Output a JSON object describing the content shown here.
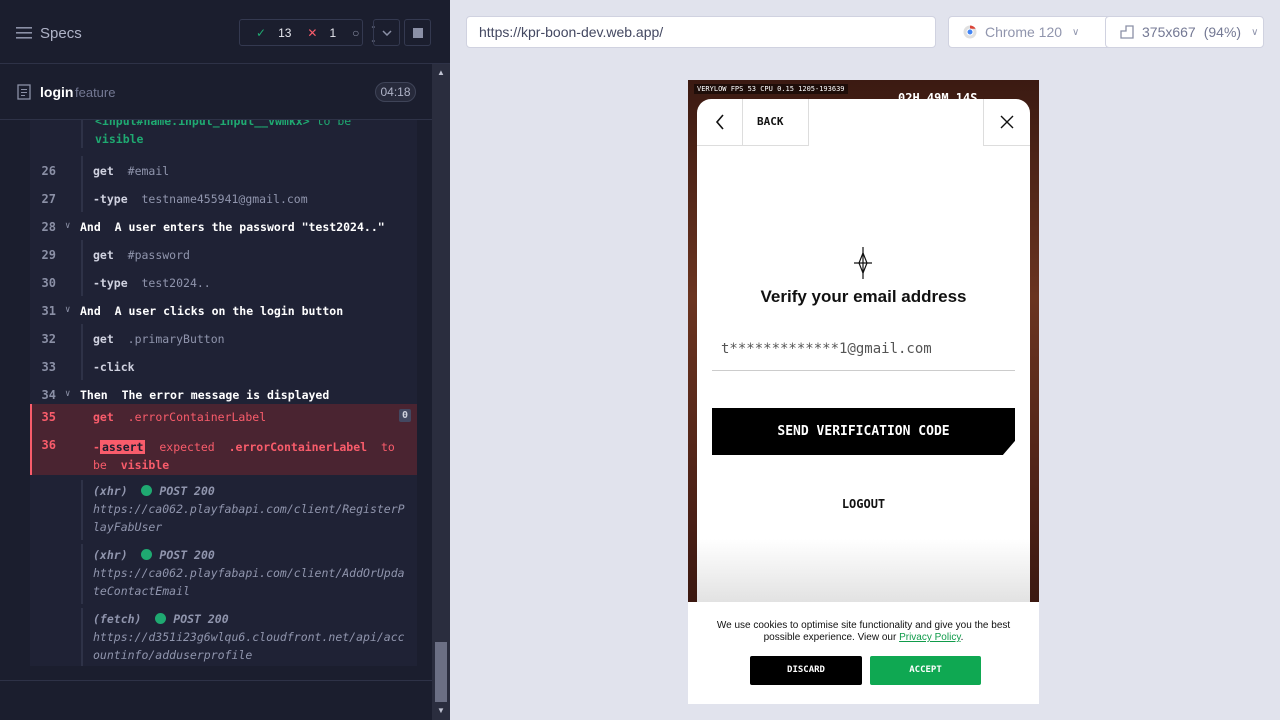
{
  "topbar": {
    "specs_label": "Specs",
    "passed": "13",
    "failed": "1",
    "pending": "--"
  },
  "spec": {
    "name": "login",
    "ext": "feature",
    "duration": "04:18"
  },
  "log": {
    "partial_top_1": "<input#name.input_input__vwmkx>",
    "partial_top_2": "to be",
    "partial_top_3": "visible",
    "lines": [
      {
        "num": "26",
        "cmd": "get",
        "arg": "#email"
      },
      {
        "num": "27",
        "cmd": "-type",
        "arg": "testname455941@gmail.com"
      },
      {
        "num": "28",
        "cmd": "And",
        "arg": "A user enters the password \"test2024..\""
      },
      {
        "num": "29",
        "cmd": "get",
        "arg": "#password"
      },
      {
        "num": "30",
        "cmd": "-type",
        "arg": "test2024.."
      },
      {
        "num": "31",
        "cmd": "And",
        "arg": "A user clicks on the login button"
      },
      {
        "num": "32",
        "cmd": "get",
        "arg": ".primaryButton"
      },
      {
        "num": "33",
        "cmd": "-click",
        "arg": ""
      },
      {
        "num": "34",
        "cmd": "Then",
        "arg": "The error message is displayed"
      },
      {
        "num": "35",
        "cmd": "get",
        "arg": ".errorContainerLabel"
      },
      {
        "num": "36",
        "cmd": "assert",
        "arg": "expected"
      }
    ],
    "line35_badge": "0",
    "assert_prefix": "-",
    "assert_label": "assert",
    "assert_expected": "expected",
    "assert_subject": ".errorContainerLabel",
    "assert_to": "to",
    "assert_be": "be",
    "assert_visible": "visible",
    "requests": [
      {
        "type": "(xhr)",
        "method": "POST 200",
        "url": "https://ca062.playfabapi.com/client/RegisterP",
        "url2": "layFabUser"
      },
      {
        "type": "(xhr)",
        "method": "POST 200",
        "url": "https://ca062.playfabapi.com/client/AddOrUpda",
        "url2": "teContactEmail"
      },
      {
        "type": "(fetch)",
        "method": "POST 200",
        "url": "https://d351i23g6wlqu6.cloudfront.net/api/acc",
        "url2": "ountinfo/adduserprofile"
      }
    ]
  },
  "aut": {
    "url": "https://kpr-boon-dev.web.app/",
    "browser": "Chrome 120",
    "viewport": "375x667",
    "zoom": "(94%)"
  },
  "app": {
    "perf": "VERYLOW  FPS 53  CPU 0.15  1205-193639",
    "timer": "02H 49M 14S",
    "back_label": "BACK",
    "title": "Verify your email address",
    "email_value": "t*************1@gmail.com",
    "send_button": "SEND VERIFICATION CODE",
    "logout_button": "LOGOUT",
    "cookie_text": "We use cookies to optimise site functionality and give you the best possible experience. View our",
    "cookie_link": "Privacy Policy",
    "cookie_end": ".",
    "discard_button": "DISCARD",
    "accept_button": "ACCEPT"
  },
  "colors": {
    "panel_bg": "#1b1e2e",
    "pass": "#1fa971",
    "fail": "#f95c6b",
    "accept": "#0fa852"
  }
}
